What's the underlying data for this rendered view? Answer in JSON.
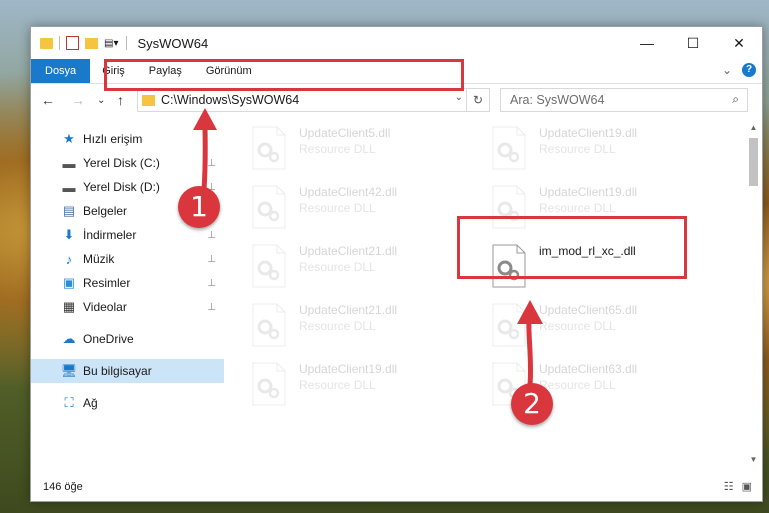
{
  "window": {
    "title": "SysWOW64",
    "minimize": "—",
    "maximize": "☐",
    "close": "✕"
  },
  "ribbon": {
    "tabs": [
      "Dosya",
      "Giriş",
      "Paylaş",
      "Görünüm"
    ],
    "expand": "⌄",
    "help": "?"
  },
  "nav": {
    "back": "←",
    "forward": "→",
    "recent": "⌄",
    "up": "↑",
    "address": "C:\\Windows\\SysWOW64",
    "address_dropdown": "⌄",
    "refresh": "↻",
    "search_placeholder": "Ara: SysWOW64",
    "search_icon": "⌕"
  },
  "sidebar": {
    "items": [
      {
        "label": "Hızlı erişim",
        "icon": "star-icon",
        "glyph": "★",
        "color": "#1979ca",
        "pinned": false
      },
      {
        "label": "Yerel Disk (C:)",
        "icon": "drive-icon",
        "glyph": "▬",
        "color": "#555",
        "pinned": true
      },
      {
        "label": "Yerel Disk (D:)",
        "icon": "drive-icon",
        "glyph": "▬",
        "color": "#555",
        "pinned": true
      },
      {
        "label": "Belgeler",
        "icon": "document-icon",
        "glyph": "▤",
        "color": "#4a6fa5",
        "pinned": true
      },
      {
        "label": "İndirmeler",
        "icon": "download-icon",
        "glyph": "⬇",
        "color": "#1979ca",
        "pinned": true
      },
      {
        "label": "Müzik",
        "icon": "music-icon",
        "glyph": "♪",
        "color": "#1979ca",
        "pinned": true
      },
      {
        "label": "Resimler",
        "icon": "pictures-icon",
        "glyph": "▣",
        "color": "#2b8fd6",
        "pinned": true
      },
      {
        "label": "Videolar",
        "icon": "video-icon",
        "glyph": "▦",
        "color": "#333",
        "pinned": true
      },
      {
        "label": "OneDrive",
        "icon": "onedrive-icon",
        "glyph": "☁",
        "color": "#1979ca",
        "pinned": false
      },
      {
        "label": "Bu bilgisayar",
        "icon": "computer-icon",
        "glyph": "🖥",
        "color": "#1979ca",
        "pinned": false
      },
      {
        "label": "Ağ",
        "icon": "network-icon",
        "glyph": "⛶",
        "color": "#1979ca",
        "pinned": false
      }
    ],
    "pin_glyph": "📌"
  },
  "files": [
    {
      "name": "UpdateClient5.dll",
      "type": "Resource DLL"
    },
    {
      "name": "UpdateClient19.dll",
      "type": "Resource DLL"
    },
    {
      "name": "UpdateClient42.dll",
      "type": "Resource DLL"
    },
    {
      "name": "UpdateClient19.dll",
      "type": "Resource DLL"
    },
    {
      "name": "UpdateClient21.dll",
      "type": "Resource DLL"
    },
    {
      "name": "im_mod_rl_xc_.dll",
      "type": ""
    },
    {
      "name": "UpdateClient21.dll",
      "type": "Resource DLL"
    },
    {
      "name": "UpdateClient65.dll",
      "type": "Resource DLL"
    },
    {
      "name": "UpdateClient19.dll",
      "type": "Resource DLL"
    },
    {
      "name": "UpdateClient63.dll",
      "type": "Resource DLL"
    }
  ],
  "status": {
    "count": "146 öğe"
  },
  "markers": {
    "one": "1",
    "two": "2"
  },
  "colors": {
    "accent": "#1979ca",
    "highlight": "#d9363e",
    "selected": "#cce4f7"
  }
}
